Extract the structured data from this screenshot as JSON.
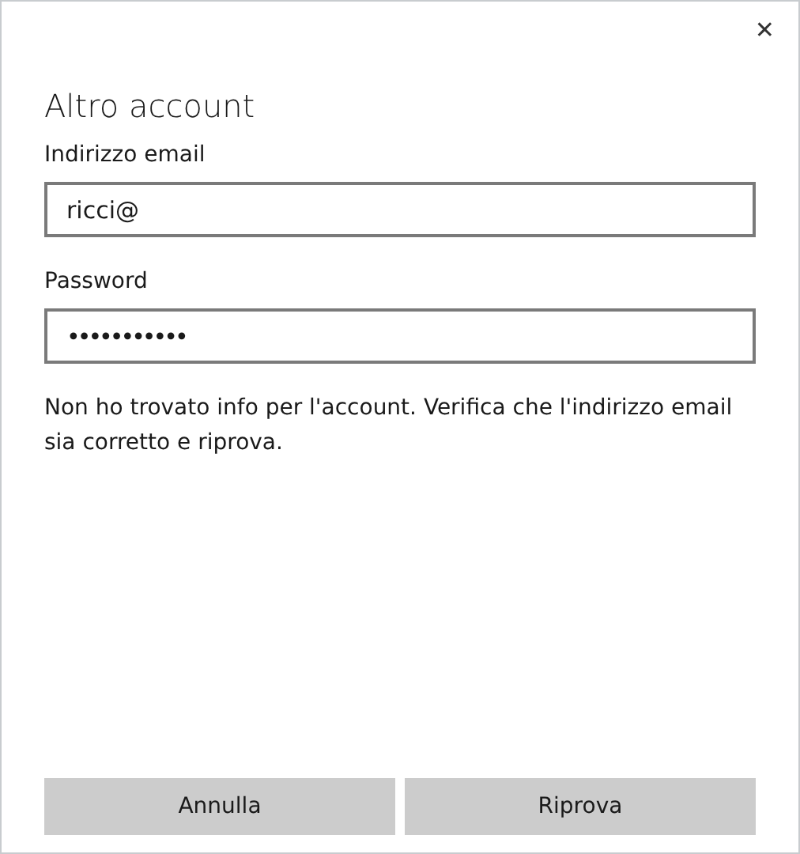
{
  "window": {
    "close_button": "✕"
  },
  "title": "Altro account",
  "fields": [
    {
      "kind": "text",
      "label": "Indirizzo email",
      "value": "ricci@"
    },
    {
      "kind": "password",
      "label": "Password",
      "value": "•••••••••••"
    }
  ],
  "error": "Non ho trovato info per l'account. Verifica che l'indirizzo email sia corretto e riprova.",
  "buttons": [
    "Annulla",
    "Riprova"
  ]
}
